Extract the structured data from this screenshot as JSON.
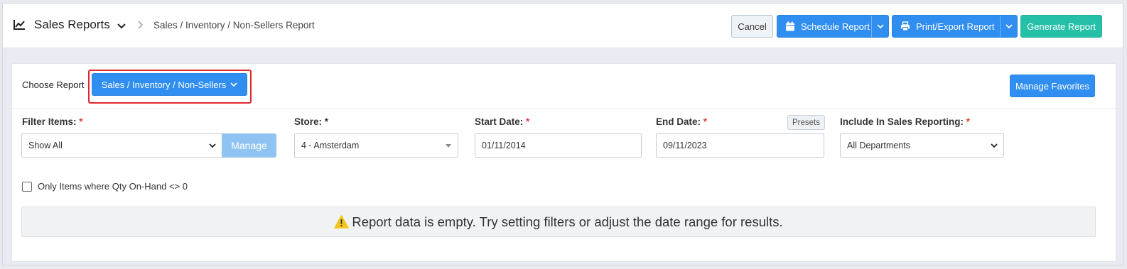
{
  "header": {
    "title": "Sales Reports",
    "breadcrumb": "Sales / Inventory / Non-Sellers Report",
    "buttons": {
      "cancel": "Cancel",
      "schedule": "Schedule Report",
      "print_export": "Print/Export Report",
      "generate": "Generate Report"
    }
  },
  "report_chooser": {
    "label": "Choose Report",
    "selected": "Sales / Inventory / Non-Sellers",
    "favorites": "Manage Favorites"
  },
  "filters": {
    "filter_items": {
      "label": "Filter Items:",
      "required": "*",
      "value": "Show All",
      "manage": "Manage"
    },
    "store": {
      "label": "Store: *",
      "value": "4 - Amsterdam"
    },
    "start_date": {
      "label": "Start Date:",
      "required": "*",
      "value": "01/11/2014"
    },
    "end_date": {
      "label": "End Date:",
      "required": "*",
      "value": "09/11/2023",
      "presets": "Presets"
    },
    "sales_reporting": {
      "label": "Include In Sales Reporting:",
      "required": "*",
      "value": "All Departments"
    }
  },
  "options": {
    "only_qty_on_hand": {
      "label": "Only Items where Qty On-Hand <> 0",
      "checked": false
    }
  },
  "message": {
    "empty": "Report data is empty. Try setting filters or adjust the date range for results.",
    "icon": "warning-icon"
  },
  "colors": {
    "primary": "#2f8ef0",
    "success": "#26c0a8",
    "manage_disabled": "#8fc3f2",
    "highlight": "#e0282e",
    "required": "#e23b3b",
    "warning": "#f5c518"
  }
}
